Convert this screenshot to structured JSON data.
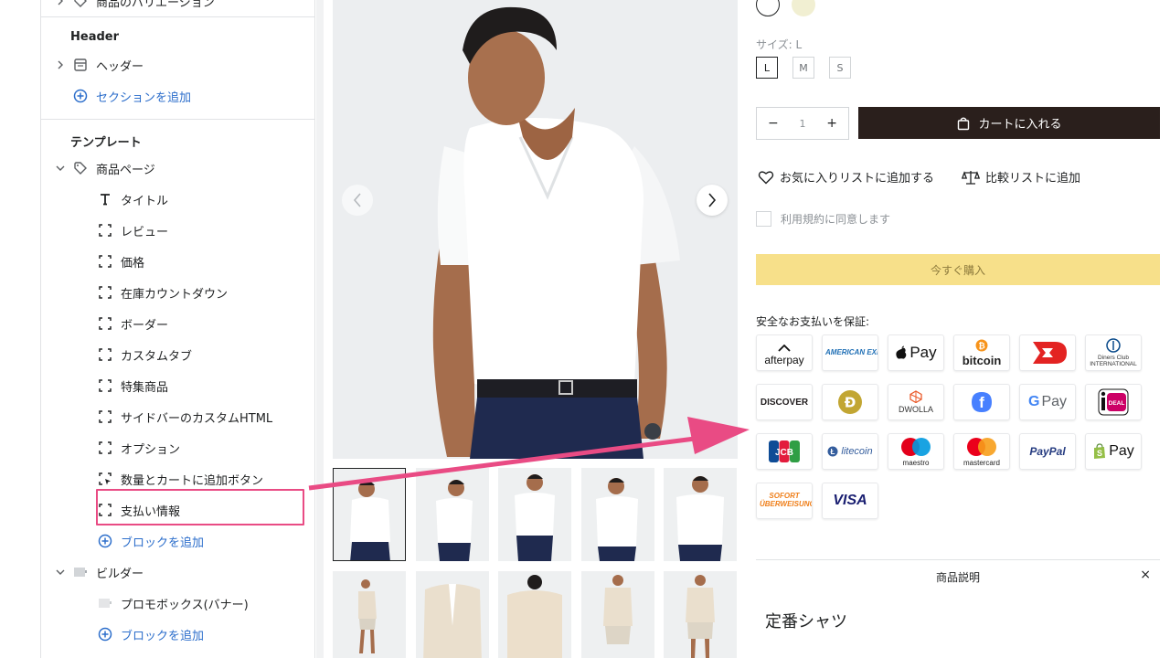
{
  "sidebar": {
    "top_item": "商品のバリエーション",
    "header_section_title": "Header",
    "header_item": "ヘッダー",
    "add_section": "セクションを追加",
    "template_title": "テンプレート",
    "product_page": "商品ページ",
    "blocks": [
      {
        "label": "タイトル",
        "icon": "text-icon"
      },
      {
        "label": "レビュー",
        "icon": "block-icon"
      },
      {
        "label": "価格",
        "icon": "block-icon"
      },
      {
        "label": "在庫カウントダウン",
        "icon": "block-icon"
      },
      {
        "label": "ボーダー",
        "icon": "block-icon"
      },
      {
        "label": "カスタムタブ",
        "icon": "block-icon"
      },
      {
        "label": "特集商品",
        "icon": "block-icon"
      },
      {
        "label": "サイドバーのカスタムHTML",
        "icon": "block-icon"
      },
      {
        "label": "オプション",
        "icon": "block-icon"
      },
      {
        "label": "数量とカートに追加ボタン",
        "icon": "cursor-block-icon"
      },
      {
        "label": "支払い情報",
        "icon": "block-icon"
      }
    ],
    "add_block": "ブロックを追加",
    "builder": "ビルダー",
    "promo_box": "プロモボックス(バナー)",
    "add_block_2": "ブロックを追加"
  },
  "product": {
    "size_label": "サイズ: L",
    "sizes": [
      "L",
      "M",
      "S"
    ],
    "selected_size": "L",
    "qty_minus": "−",
    "qty_value": "1",
    "qty_plus": "+",
    "cart_button": "カートに入れる",
    "wishlist": "お気に入りリストに追加する",
    "compare": "比較リストに追加",
    "terms": "利用規約に同意します",
    "buy_now": "今すぐ購入",
    "payment_title": "安全なお支払いを保証:",
    "description_tab": "商品説明",
    "description_close": "×",
    "description_heading": "定番シャツ"
  },
  "payment_methods": [
    {
      "name": "afterpay",
      "label": "afterpay"
    },
    {
      "name": "american-express",
      "label": "AMERICAN EXPRESS"
    },
    {
      "name": "apple-pay",
      "label": "Pay"
    },
    {
      "name": "bitcoin",
      "label": "bitcoin"
    },
    {
      "name": "dankort",
      "label": "DK"
    },
    {
      "name": "diners-club",
      "label": "Diners Club INTERNATIONAL"
    },
    {
      "name": "discover",
      "label": "DISCOVER"
    },
    {
      "name": "dogecoin",
      "label": "Đ"
    },
    {
      "name": "dwolla",
      "label": "DWOLLA"
    },
    {
      "name": "forbrugsforeningen",
      "label": "f"
    },
    {
      "name": "google-pay",
      "label": "Pay"
    },
    {
      "name": "ideal",
      "label": "iDEAL"
    },
    {
      "name": "jcb",
      "label": "JCB"
    },
    {
      "name": "litecoin",
      "label": "litecoin"
    },
    {
      "name": "maestro",
      "label": "maestro"
    },
    {
      "name": "mastercard",
      "label": "mastercard"
    },
    {
      "name": "paypal",
      "label": "PayPal"
    },
    {
      "name": "shopify-pay",
      "label": "Pay"
    },
    {
      "name": "sofort",
      "label": "SOFORT ÜBERWEISUNG"
    },
    {
      "name": "visa",
      "label": "VISA"
    }
  ],
  "colors": {
    "accent_blue": "#2c6ecb",
    "highlight": "#e94b84",
    "cart_button": "#2a1f1c",
    "buy_now": "#f7e08a"
  }
}
